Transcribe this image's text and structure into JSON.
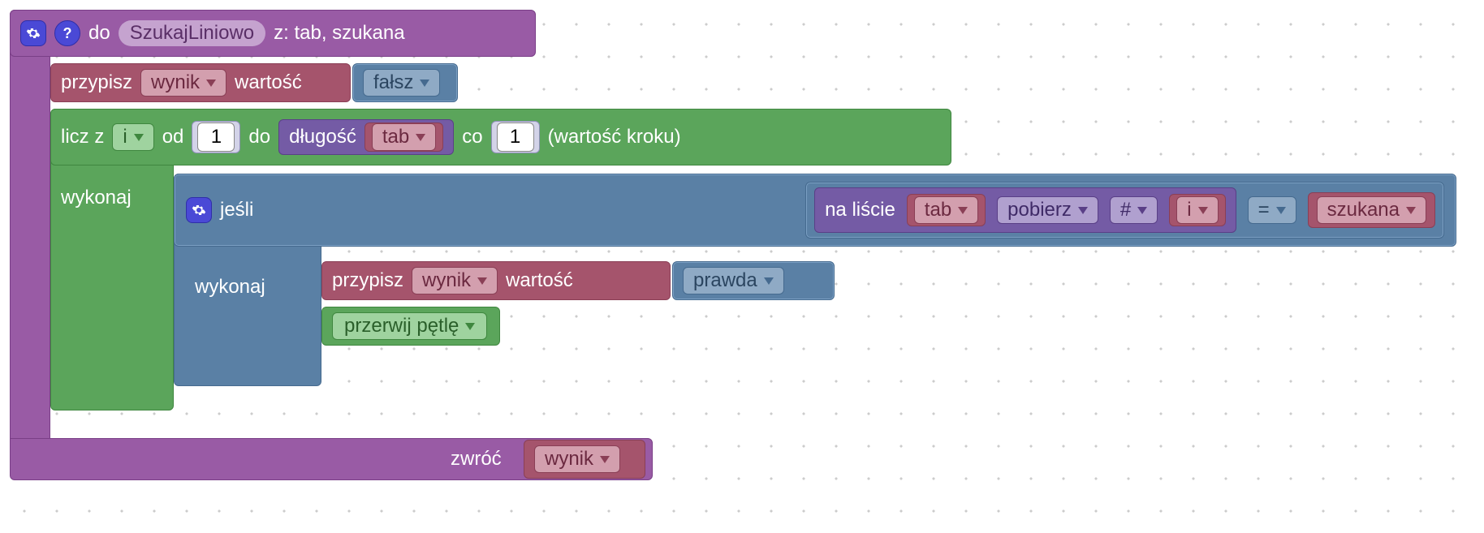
{
  "header": {
    "do": "do",
    "name": "SzukajLiniowo",
    "params": "z: tab, szukana"
  },
  "set1": {
    "assign": "przypisz",
    "var": "wynik",
    "value_label": "wartość",
    "value": "fałsz"
  },
  "loop": {
    "count": "licz z",
    "var": "i",
    "from": "od",
    "from_val": "1",
    "to": "do",
    "length": "długość",
    "length_arg": "tab",
    "step": "co",
    "step_val": "1",
    "step_note": "(wartość kroku)",
    "do": "wykonaj"
  },
  "ifblk": {
    "if": "jeśli",
    "inlist": "na liście",
    "list_arg": "tab",
    "get": "pobierz",
    "hash": "#",
    "index_var": "i",
    "op": "=",
    "rhs": "szukana",
    "do": "wykonaj"
  },
  "set2": {
    "assign": "przypisz",
    "var": "wynik",
    "value_label": "wartość",
    "value": "prawda"
  },
  "brk": {
    "label": "przerwij pętlę"
  },
  "ret": {
    "label": "zwróć",
    "var": "wynik"
  }
}
